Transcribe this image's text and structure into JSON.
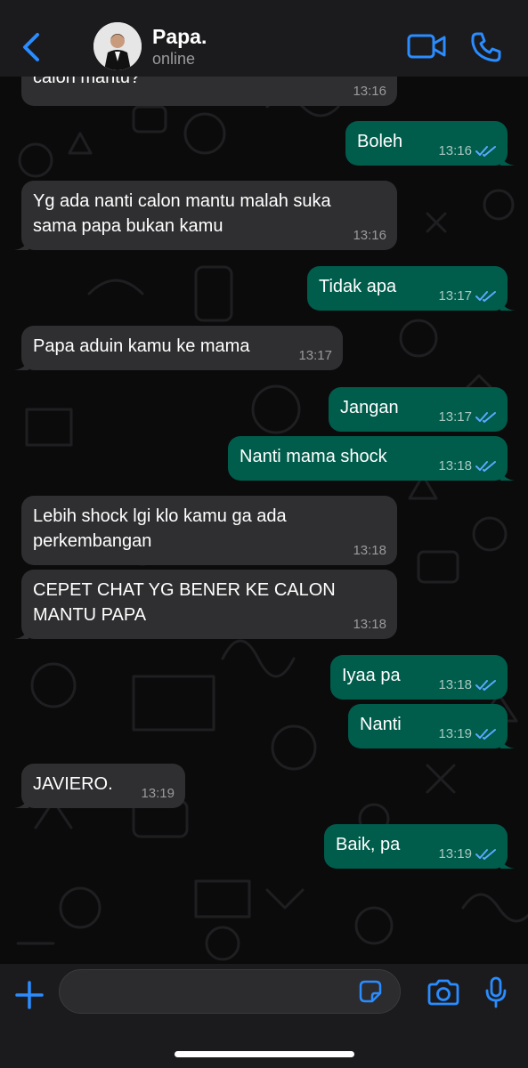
{
  "header": {
    "contact_name": "Papa.",
    "contact_status": "online"
  },
  "colors": {
    "background": "#0b0b0c",
    "header": "#1b1b1d",
    "incoming_bubble": "#2f2f31",
    "outgoing_bubble": "#005c4b",
    "accent": "#2a8cff",
    "read_ticks": "#5aa9ff"
  },
  "icons": {
    "back": "chevron-left-icon",
    "video": "video-camera-icon",
    "call": "phone-icon",
    "plus": "plus-icon",
    "sticker": "sticker-icon",
    "camera": "camera-icon",
    "mic": "microphone-icon"
  },
  "messages": [
    {
      "dir": "in",
      "text": "calon mantu?",
      "time": "13:16"
    },
    {
      "dir": "out",
      "text": "Boleh",
      "time": "13:16",
      "read": true
    },
    {
      "dir": "in",
      "text": "Yg ada nanti calon mantu malah suka\nsama papa bukan kamu",
      "time": "13:16"
    },
    {
      "dir": "out",
      "text": "Tidak apa",
      "time": "13:17",
      "read": true
    },
    {
      "dir": "in",
      "text": "Papa aduin kamu ke mama",
      "time": "13:17"
    },
    {
      "dir": "out",
      "text": "Jangan",
      "time": "13:17",
      "read": true
    },
    {
      "dir": "out",
      "text": "Nanti mama shock",
      "time": "13:18",
      "read": true
    },
    {
      "dir": "in",
      "text": "Lebih shock lgi klo kamu ga ada\nperkembangan",
      "time": "13:18"
    },
    {
      "dir": "in",
      "text": "CEPET CHAT YG BENER KE CALON\nMANTU PAPA",
      "time": "13:18"
    },
    {
      "dir": "out",
      "text": "Iyaa pa",
      "time": "13:18",
      "read": true
    },
    {
      "dir": "out",
      "text": "Nanti",
      "time": "13:19",
      "read": true
    },
    {
      "dir": "in",
      "text": "JAVIERO.",
      "time": "13:19"
    },
    {
      "dir": "out",
      "text": "Baik, pa",
      "time": "13:19",
      "read": true
    }
  ],
  "composer": {
    "value": "",
    "placeholder": ""
  }
}
